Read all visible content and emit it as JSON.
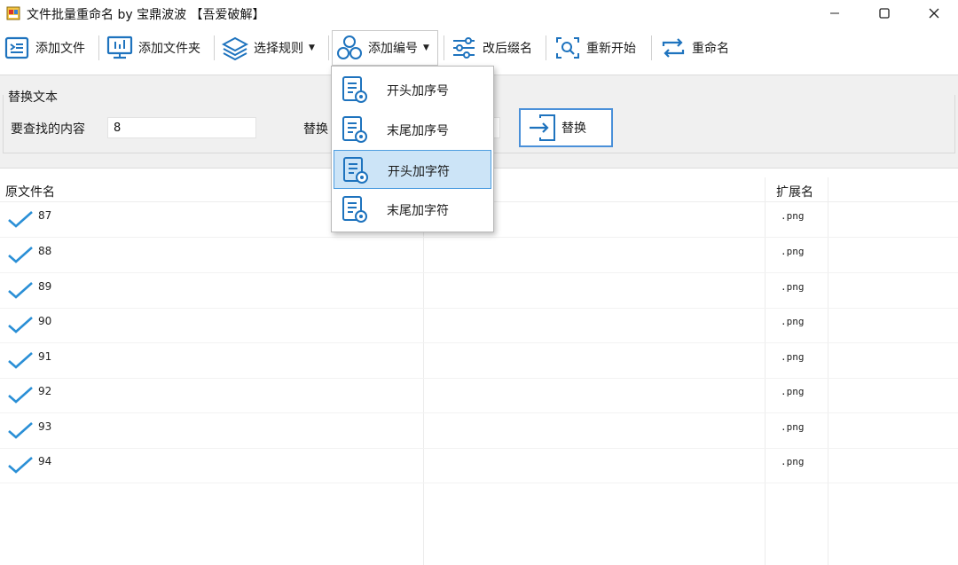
{
  "window": {
    "title": "文件批量重命名 by 宝鼎波波 【吾爱破解】"
  },
  "toolbar": {
    "add_file": "添加文件",
    "add_folder": "添加文件夹",
    "select_rule": "选择规则",
    "add_number": "添加编号",
    "change_suffix": "改后缀名",
    "restart": "重新开始",
    "rename": "重命名"
  },
  "replace_panel": {
    "title": "替换文本",
    "find_label": "要查找的内容",
    "find_value": "8",
    "replace_label": "替换",
    "replace_value": "",
    "replace_button": "替换"
  },
  "dropdown": {
    "items": [
      {
        "label": "开头加序号",
        "highlighted": false
      },
      {
        "label": "末尾加序号",
        "highlighted": false
      },
      {
        "label": "开头加字符",
        "highlighted": true
      },
      {
        "label": "末尾加字符",
        "highlighted": false
      }
    ]
  },
  "list": {
    "columns": {
      "original_name": "原文件名",
      "extension": "扩展名"
    },
    "rows": [
      {
        "name": "87",
        "ext": ".png"
      },
      {
        "name": "88",
        "ext": ".png"
      },
      {
        "name": "89",
        "ext": ".png"
      },
      {
        "name": "90",
        "ext": ".png"
      },
      {
        "name": "91",
        "ext": ".png"
      },
      {
        "name": "92",
        "ext": ".png"
      },
      {
        "name": "93",
        "ext": ".png"
      },
      {
        "name": "94",
        "ext": ".png"
      }
    ]
  },
  "colors": {
    "accent": "#1e73be",
    "check": "#2a8fd6",
    "highlight_bg": "#cce4f7",
    "highlight_border": "#4d9de0"
  }
}
